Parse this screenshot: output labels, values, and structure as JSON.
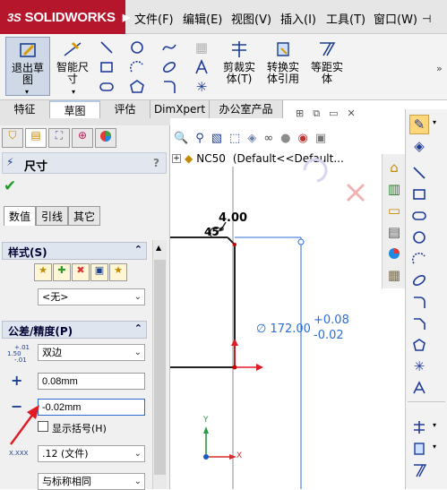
{
  "app": {
    "brand": "SOLIDWORKS",
    "brand_mark": "3S"
  },
  "menu": [
    "文件(F)",
    "编辑(E)",
    "视图(V)",
    "插入(I)",
    "工具(T)",
    "窗口(W)"
  ],
  "ribbon": {
    "exit_sketch": "退出草图",
    "smart_dimension": "智能尺寸",
    "trim": "剪裁实体(T)",
    "convert": "转换实体引用",
    "offset": "等距实体"
  },
  "tabs": [
    "特征",
    "草图",
    "评估",
    "DimXpert",
    "办公室产品"
  ],
  "panel": {
    "title": "尺寸",
    "help": "?",
    "subtabs": [
      "数值",
      "引线",
      "其它"
    ],
    "style_group": {
      "title": "样式(S)",
      "value": "<无>"
    },
    "tolerance_group": {
      "title": "公差/精度(P)",
      "tol_type": "双边",
      "upper": "0.08mm",
      "lower": "-0.02mm",
      "show_parens": "显示括号(H)",
      "precision": ".12 (文件)",
      "tol_precision": "与标称相同",
      "tol_icon_top": "1.50",
      "tol_icon_sup": "+.01",
      "tol_icon_sub": "-.01",
      "prec_icon": "X.XXX"
    }
  },
  "tree": {
    "label": "NC50",
    "config": "(Default<<Default..."
  },
  "drawing": {
    "top_dim": "4.00",
    "angle_dim": "45°",
    "diameter": "∅ 172.00",
    "tol_upper": "+0.08",
    "tol_lower": "-0.02",
    "axis_y": "Y",
    "axis_x": "X"
  },
  "colors": {
    "accent": "#b5162b",
    "dim_blue": "#2a6ed8",
    "select_yellow": "#ffd77a",
    "arrow_red": "#e01b24"
  }
}
